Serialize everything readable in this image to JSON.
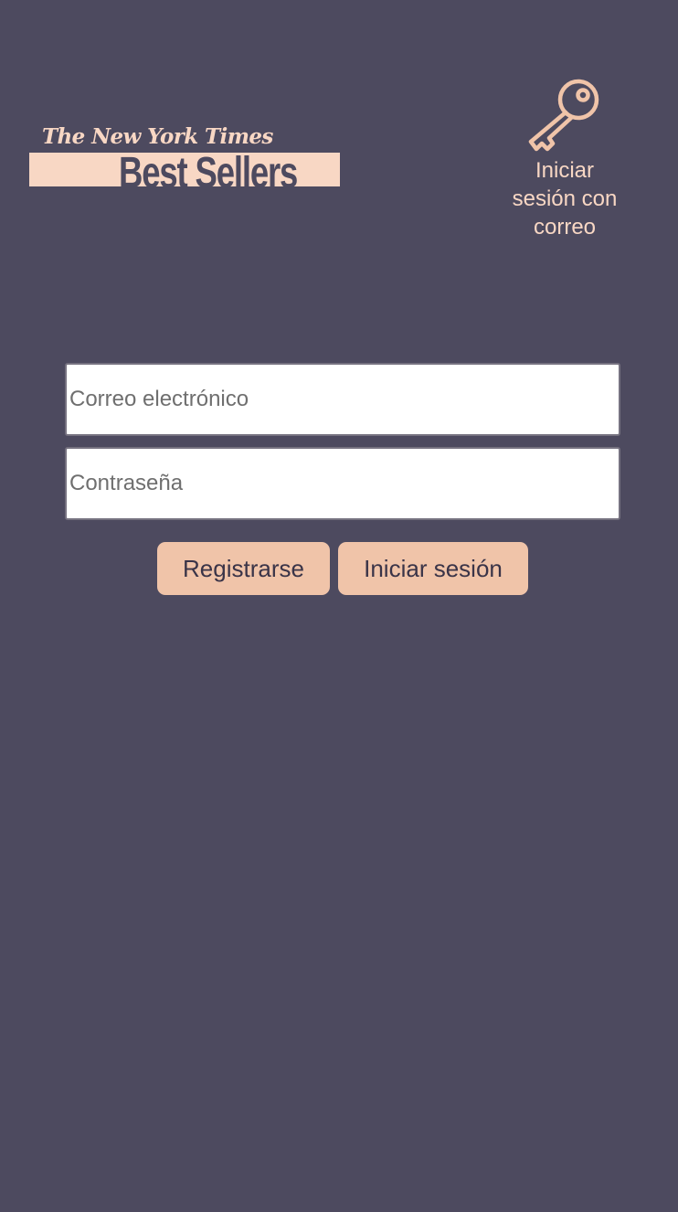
{
  "logo": {
    "masthead": "The New York Times",
    "wordmark": "Best Sellers"
  },
  "email_login": {
    "icon": "key-icon",
    "label": "Iniciar sesión con correo"
  },
  "form": {
    "email_placeholder": "Correo electrónico",
    "email_value": "",
    "password_placeholder": "Contraseña",
    "password_value": ""
  },
  "actions": {
    "register_label": "Registrarse",
    "login_label": "Iniciar sesión"
  },
  "colors": {
    "background": "#4d4a5f",
    "accent": "#f0c4a9",
    "logo": "#f8d7c4"
  }
}
